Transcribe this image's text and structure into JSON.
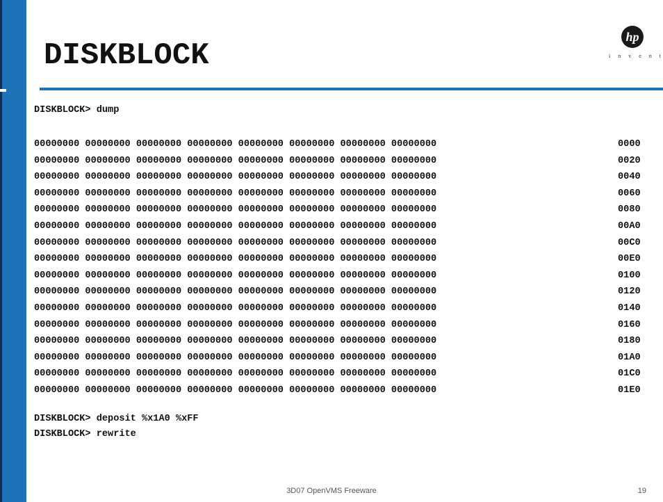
{
  "slide": {
    "title": "DISKBLOCK",
    "logo": {
      "text": "i n v e n t",
      "mark_text": "hp",
      "icon": "hp-logo-icon"
    },
    "accent_color": "#1e73b8"
  },
  "console": {
    "command_dump": "DISKBLOCK> dump",
    "dump_rows": [
      {
        "words": "00000000 00000000 00000000 00000000 00000000 00000000 00000000 00000000",
        "offset": "0000"
      },
      {
        "words": "00000000 00000000 00000000 00000000 00000000 00000000 00000000 00000000",
        "offset": "0020"
      },
      {
        "words": "00000000 00000000 00000000 00000000 00000000 00000000 00000000 00000000",
        "offset": "0040"
      },
      {
        "words": "00000000 00000000 00000000 00000000 00000000 00000000 00000000 00000000",
        "offset": "0060"
      },
      {
        "words": "00000000 00000000 00000000 00000000 00000000 00000000 00000000 00000000",
        "offset": "0080"
      },
      {
        "words": "00000000 00000000 00000000 00000000 00000000 00000000 00000000 00000000",
        "offset": "00A0"
      },
      {
        "words": "00000000 00000000 00000000 00000000 00000000 00000000 00000000 00000000",
        "offset": "00C0"
      },
      {
        "words": "00000000 00000000 00000000 00000000 00000000 00000000 00000000 00000000",
        "offset": "00E0"
      },
      {
        "words": "00000000 00000000 00000000 00000000 00000000 00000000 00000000 00000000",
        "offset": "0100"
      },
      {
        "words": "00000000 00000000 00000000 00000000 00000000 00000000 00000000 00000000",
        "offset": "0120"
      },
      {
        "words": "00000000 00000000 00000000 00000000 00000000 00000000 00000000 00000000",
        "offset": "0140"
      },
      {
        "words": "00000000 00000000 00000000 00000000 00000000 00000000 00000000 00000000",
        "offset": "0160"
      },
      {
        "words": "00000000 00000000 00000000 00000000 00000000 00000000 00000000 00000000",
        "offset": "0180"
      },
      {
        "words": "00000000 00000000 00000000 00000000 00000000 00000000 00000000 00000000",
        "offset": "01A0"
      },
      {
        "words": "00000000 00000000 00000000 00000000 00000000 00000000 00000000 00000000",
        "offset": "01C0"
      },
      {
        "words": "00000000 00000000 00000000 00000000 00000000 00000000 00000000 00000000",
        "offset": "01E0"
      }
    ],
    "command_deposit": "DISKBLOCK> deposit %x1A0 %xFF",
    "command_rewrite": "DISKBLOCK> rewrite"
  },
  "footer": {
    "center_text": "3D07  OpenVMS Freeware",
    "page_number": "19"
  }
}
